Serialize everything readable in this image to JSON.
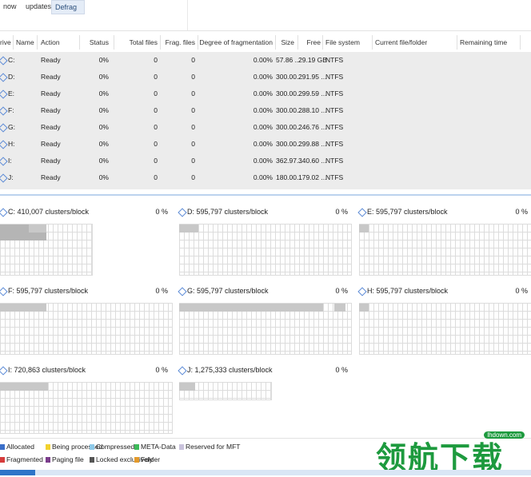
{
  "ribbon": {
    "tabs": [
      {
        "label": "now",
        "selected": false
      },
      {
        "label": "updates...",
        "selected": false
      },
      {
        "label": "Defrag",
        "selected": true
      }
    ]
  },
  "table": {
    "headers": [
      "rive",
      "Name",
      "Action",
      "Status",
      "Total files",
      "Frag. files",
      "Degree of fragmentation",
      "Size",
      "Free",
      "File system",
      "Current file/folder",
      "Remaining time"
    ],
    "rows": [
      {
        "drive": "C:",
        "action": "Ready",
        "status": "0%",
        "total": "0",
        "frag": "0",
        "degree": "0.00%",
        "size": "57.86 ...",
        "free": "29.19 GB",
        "fs": "NTFS"
      },
      {
        "drive": "D:",
        "action": "Ready",
        "status": "0%",
        "total": "0",
        "frag": "0",
        "degree": "0.00%",
        "size": "300.00...",
        "free": "291.95 ...",
        "fs": "NTFS"
      },
      {
        "drive": "E:",
        "action": "Ready",
        "status": "0%",
        "total": "0",
        "frag": "0",
        "degree": "0.00%",
        "size": "300.00...",
        "free": "299.59 ...",
        "fs": "NTFS"
      },
      {
        "drive": "F:",
        "action": "Ready",
        "status": "0%",
        "total": "0",
        "frag": "0",
        "degree": "0.00%",
        "size": "300.00...",
        "free": "288.10 ...",
        "fs": "NTFS"
      },
      {
        "drive": "G:",
        "action": "Ready",
        "status": "0%",
        "total": "0",
        "frag": "0",
        "degree": "0.00%",
        "size": "300.00...",
        "free": "246.76 ...",
        "fs": "NTFS"
      },
      {
        "drive": "H:",
        "action": "Ready",
        "status": "0%",
        "total": "0",
        "frag": "0",
        "degree": "0.00%",
        "size": "300.00...",
        "free": "299.88 ...",
        "fs": "NTFS"
      },
      {
        "drive": "I:",
        "action": "Ready",
        "status": "0%",
        "total": "0",
        "frag": "0",
        "degree": "0.00%",
        "size": "362.97...",
        "free": "340.60 ...",
        "fs": "NTFS"
      },
      {
        "drive": "J:",
        "action": "Ready",
        "status": "0%",
        "total": "0",
        "frag": "0",
        "degree": "0.00%",
        "size": "180.00...",
        "free": "179.02 ...",
        "fs": "NTFS"
      }
    ]
  },
  "maps": [
    {
      "label": "C: 410,007 clusters/block",
      "pct": "0 %"
    },
    {
      "label": "D: 595,797 clusters/block",
      "pct": "0 %"
    },
    {
      "label": "E: 595,797 clusters/block",
      "pct": "0 %"
    },
    {
      "label": "F: 595,797 clusters/block",
      "pct": "0 %"
    },
    {
      "label": "G: 595,797 clusters/block",
      "pct": "0 %"
    },
    {
      "label": "H: 595,797 clusters/block",
      "pct": "0 %"
    },
    {
      "label": "I: 720,863 clusters/block",
      "pct": "0 %"
    },
    {
      "label": "J: 1,275,333 clusters/block",
      "pct": "0 %"
    }
  ],
  "legend": {
    "items": [
      {
        "label": "Allocated",
        "color": "#3b6fc9"
      },
      {
        "label": "Being processed",
        "color": "#f2d22e"
      },
      {
        "label": "Compressed",
        "color": "#8ec9e8"
      },
      {
        "label": "META-Data",
        "color": "#3dbb5a"
      },
      {
        "label": "Reserved for MFT",
        "color": "#c9c2dc"
      },
      {
        "label": "Fragmented",
        "color": "#d63c3c"
      },
      {
        "label": "Paging file",
        "color": "#7b3d8c"
      },
      {
        "label": "Locked exclusively",
        "color": "#555555"
      },
      {
        "label": "Folder",
        "color": "#e39a2c"
      }
    ]
  },
  "watermark": {
    "text": "领航下载",
    "site": "lhdown.com"
  }
}
